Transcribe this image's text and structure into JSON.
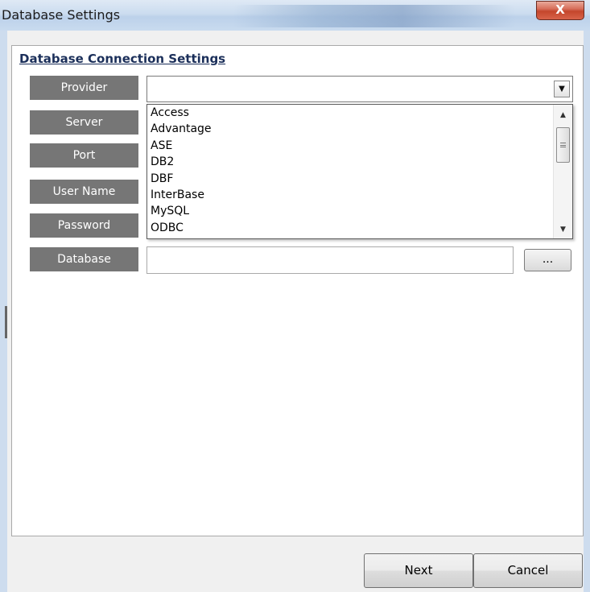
{
  "window": {
    "title": "Database Settings",
    "close_label": "X"
  },
  "section": {
    "title": "Database Connection Settings"
  },
  "fields": {
    "provider": "Provider",
    "server": "Server",
    "port": "Port",
    "user_name": "User Name",
    "password": "Password",
    "database": "Database"
  },
  "provider_select": {
    "value": "",
    "arrow_icon": "chevron-down-icon",
    "options": [
      "Access",
      "Advantage",
      "ASE",
      "DB2",
      "DBF",
      "InterBase",
      "MySQL",
      "ODBC"
    ]
  },
  "database_input": {
    "value": ""
  },
  "browse_button": {
    "label": "..."
  },
  "footer": {
    "next_label": "Next",
    "cancel_label": "Cancel"
  },
  "colors": {
    "label_bg": "#767676",
    "title_bar": "#cbdcef",
    "close_red": "#c4462c"
  }
}
